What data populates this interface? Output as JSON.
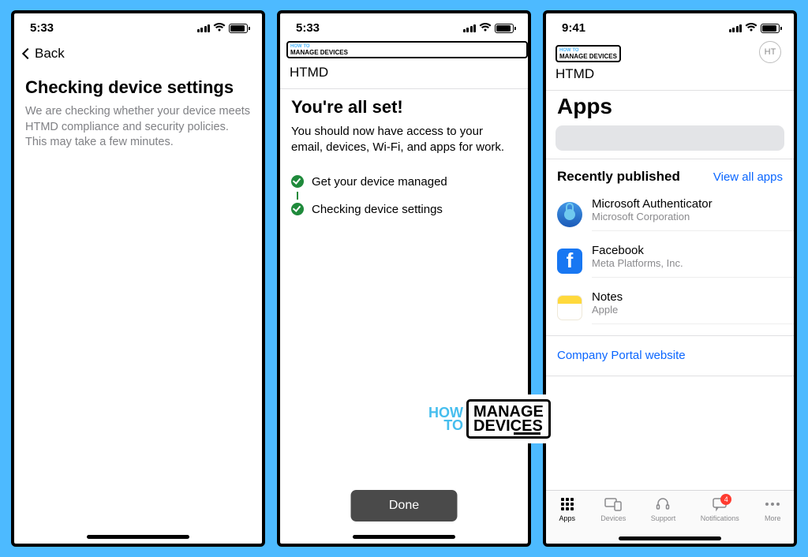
{
  "screen1": {
    "time": "5:33",
    "back": "Back",
    "headline": "Checking device settings",
    "subtext": "We are checking whether your device meets HTMD compliance and security policies. This may take a few minutes."
  },
  "screen2": {
    "time": "5:33",
    "logo_line1": "HOW TO",
    "logo_line2": "MANAGE DEVICES",
    "org": "HTMD",
    "headline": "You're all set!",
    "subtext": "You should now have access to your email, devices, Wi-Fi, and apps for work.",
    "steps": [
      "Get your device managed",
      "Checking device settings"
    ],
    "done": "Done"
  },
  "screen3": {
    "time": "9:41",
    "logo_line1": "HOW TO",
    "logo_line2": "MANAGE DEVICES",
    "org": "HTMD",
    "avatar": "HT",
    "apps_title": "Apps",
    "search_placeholder": "",
    "section_title": "Recently published",
    "view_all": "View all apps",
    "apps": [
      {
        "name": "Microsoft Authenticator",
        "publisher": "Microsoft Corporation"
      },
      {
        "name": "Facebook",
        "publisher": "Meta Platforms, Inc."
      },
      {
        "name": "Notes",
        "publisher": "Apple"
      }
    ],
    "portal_link": "Company Portal website",
    "tabs": [
      {
        "label": "Apps"
      },
      {
        "label": "Devices"
      },
      {
        "label": "Support"
      },
      {
        "label": "Notifications",
        "badge": "4"
      },
      {
        "label": "More"
      }
    ]
  },
  "watermark": {
    "howto_line1": "HOW",
    "howto_line2": "TO",
    "md_line1": "MANAGE",
    "md_line2": "DEVICES"
  }
}
